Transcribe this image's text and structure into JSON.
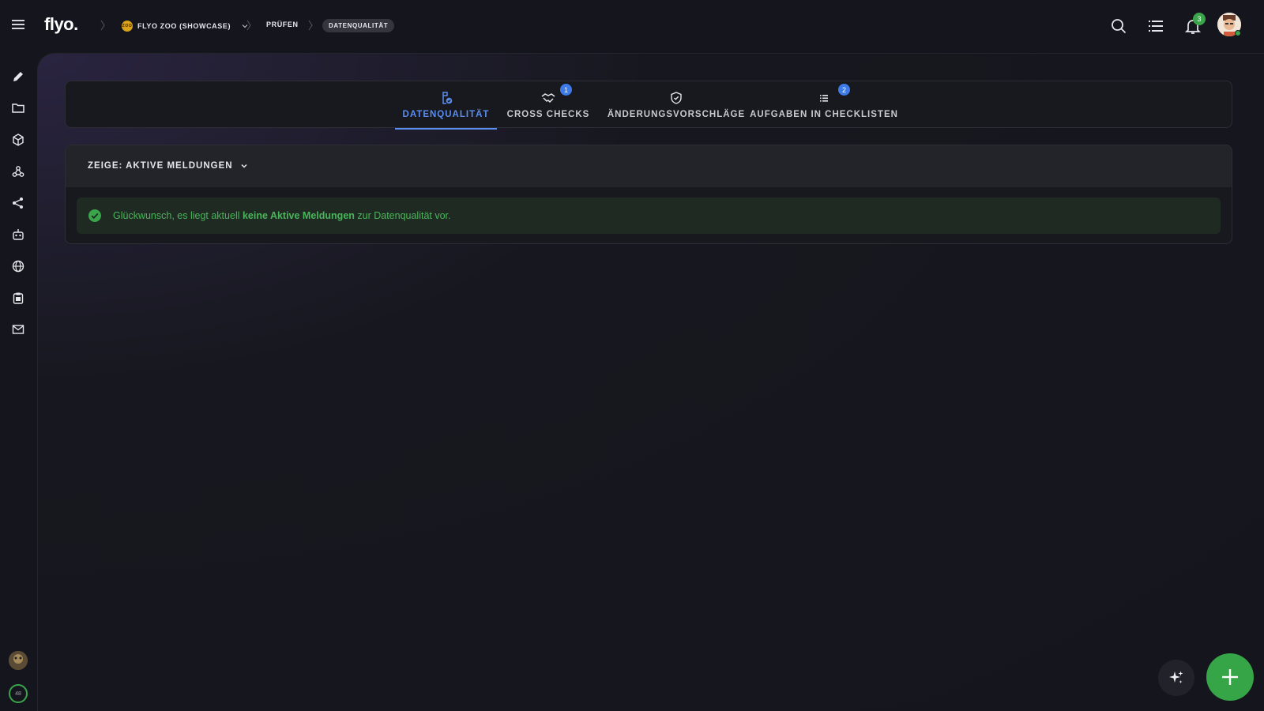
{
  "app": {
    "logo": "flyo."
  },
  "breadcrumb": {
    "project_badge": "ZOO",
    "project": "FLYO ZOO (SHOWCASE)",
    "section": "PRÜFEN",
    "current": "DATENQUALITÄT"
  },
  "header": {
    "notifications_count": "3"
  },
  "tabs": [
    {
      "label": "DATENQUALITÄT",
      "active": true
    },
    {
      "label": "CROSS CHECKS",
      "badge": "1"
    },
    {
      "label": "ÄNDERUNGSVORSCHLÄGE"
    },
    {
      "label": "AUFGABEN IN CHECKLISTEN",
      "badge": "2"
    }
  ],
  "filter": {
    "label": "ZEIGE: AKTIVE MELDUNGEN"
  },
  "message": {
    "prefix": "Glückwunsch, es liegt aktuell ",
    "emphasis": "keine Aktive Meldungen",
    "suffix": " zur Datenqualität vor."
  },
  "rail": {
    "progress_value": "48",
    "icons": [
      "pencil-icon",
      "folder-icon",
      "cube-icon",
      "webhook-icon",
      "share-icon",
      "robot-icon",
      "globe-icon",
      "clipboard-icon",
      "mail-icon"
    ]
  },
  "colors": {
    "accent": "#5b8def",
    "success": "#49b55a",
    "fab": "#36a548",
    "background": "#15161d"
  }
}
